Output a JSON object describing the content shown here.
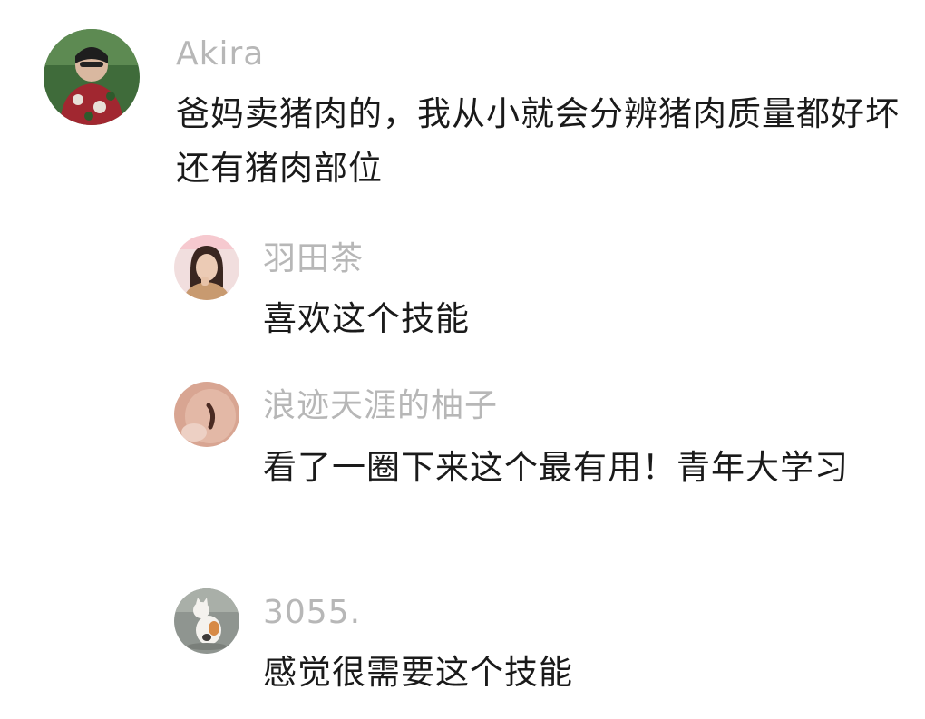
{
  "thread": {
    "main_comment": {
      "author": "Akira",
      "text": "爸妈卖猪肉的，我从小就会分辨猪肉质量都好坏还有猪肉部位",
      "avatar_icon": "user-avatar-icon"
    },
    "replies": [
      {
        "author": "羽田茶",
        "text": "喜欢这个技能",
        "avatar_icon": "user-avatar-icon"
      },
      {
        "author": "浪迹天涯的柚子",
        "text": "看了一圈下来这个最有用！青年大学习",
        "avatar_icon": "user-avatar-icon"
      },
      {
        "author": "3055.",
        "text": "感觉很需要这个技能",
        "avatar_icon": "user-avatar-icon"
      }
    ]
  },
  "colors": {
    "author_name": "#b7b7b7",
    "comment_text": "#1a1a1a",
    "background": "#ffffff"
  }
}
